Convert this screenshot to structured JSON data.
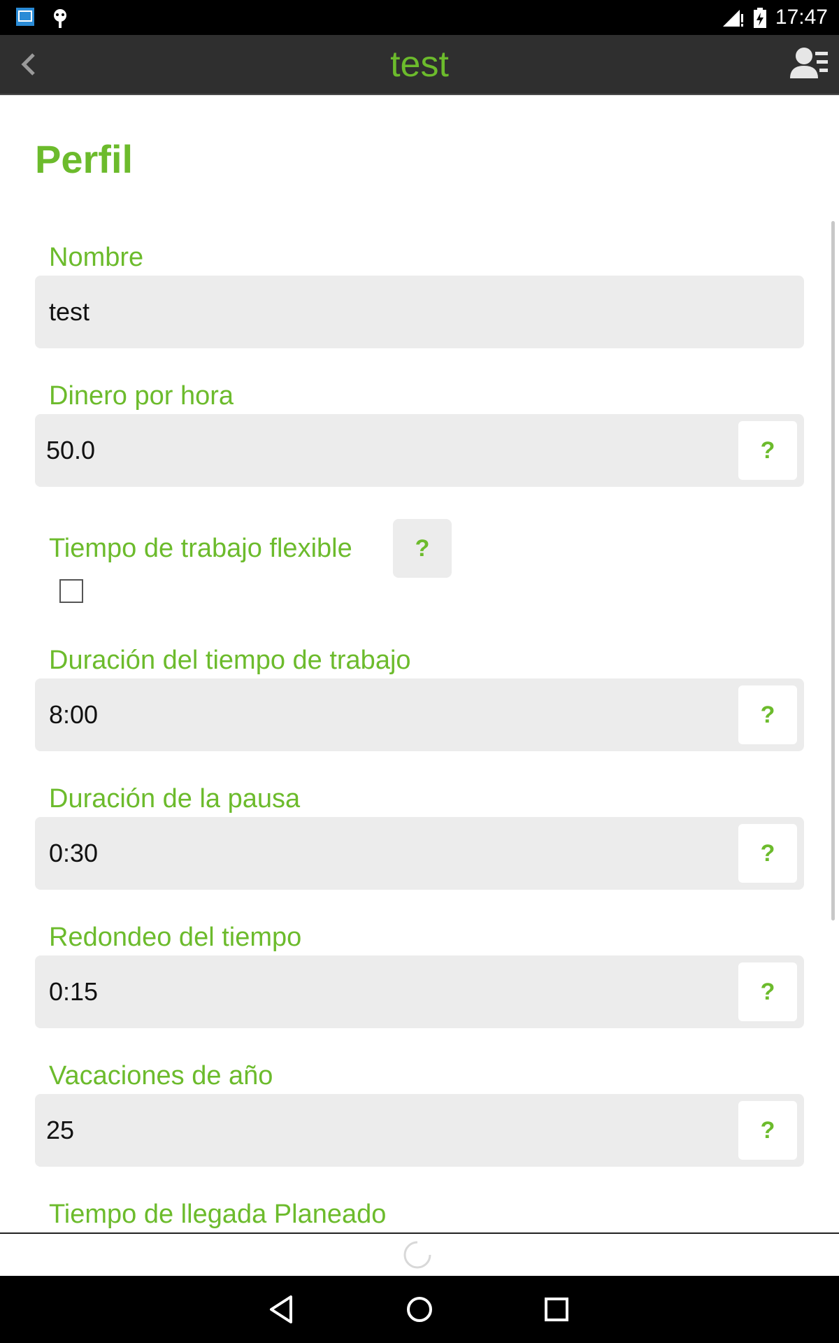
{
  "status_bar": {
    "time": "17:47",
    "icons": [
      "screenshot-icon",
      "android-debug-icon",
      "signal-icon",
      "battery-charging-icon"
    ]
  },
  "app_bar": {
    "title": "test",
    "back_icon": "chevron-left-icon",
    "profile_icon": "profile-list-icon"
  },
  "page": {
    "title": "Perfil"
  },
  "form": {
    "name": {
      "label": "Nombre",
      "value": "test"
    },
    "money_per_hour": {
      "label": "Dinero por hora",
      "value": "50.0",
      "help": "?"
    },
    "flexible_time": {
      "label": "Tiempo de trabajo flexible",
      "checked": false,
      "help": "?"
    },
    "work_duration": {
      "label": "Duración del tiempo de trabajo",
      "value": "8:00",
      "help": "?"
    },
    "pause_duration": {
      "label": "Duración de la pausa",
      "value": "0:30",
      "help": "?"
    },
    "time_rounding": {
      "label": "Redondeo del tiempo",
      "value": "0:15",
      "help": "?"
    },
    "vacation": {
      "label": "Vacaciones de año",
      "value": "25",
      "help": "?"
    },
    "planned_arrival": {
      "label": "Tiempo de llegada Planeado"
    }
  },
  "nav_bar": {
    "icons": [
      "back-triangle-icon",
      "home-circle-icon",
      "recents-square-icon"
    ]
  },
  "colors": {
    "accent": "#6cbb2c",
    "app_bar": "#2f2f2f",
    "field_bg": "#ececec"
  }
}
